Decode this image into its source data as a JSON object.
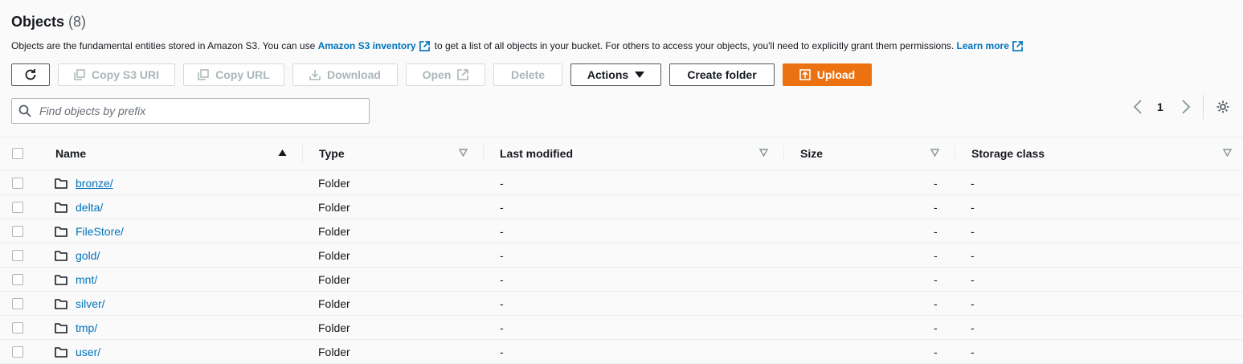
{
  "header": {
    "title": "Objects",
    "count": "(8)"
  },
  "description": {
    "part1": "Objects are the fundamental entities stored in Amazon S3. You can use ",
    "link1": "Amazon S3 inventory",
    "part2": "to get a list of all objects in your bucket. For others to access your objects, you'll need to explicitly grant them permissions. ",
    "link2": "Learn more"
  },
  "toolbar": {
    "copy_s3_uri": "Copy S3 URI",
    "copy_url": "Copy URL",
    "download": "Download",
    "open": "Open",
    "delete": "Delete",
    "actions": "Actions",
    "create_folder": "Create folder",
    "upload": "Upload"
  },
  "search": {
    "placeholder": "Find objects by prefix"
  },
  "pagination": {
    "page": "1"
  },
  "table": {
    "columns": [
      "Name",
      "Type",
      "Last modified",
      "Size",
      "Storage class"
    ],
    "rows": [
      {
        "name": "bronze/",
        "type": "Folder",
        "last_modified": "-",
        "size": "-",
        "storage_class": "-"
      },
      {
        "name": "delta/",
        "type": "Folder",
        "last_modified": "-",
        "size": "-",
        "storage_class": "-"
      },
      {
        "name": "FileStore/",
        "type": "Folder",
        "last_modified": "-",
        "size": "-",
        "storage_class": "-"
      },
      {
        "name": "gold/",
        "type": "Folder",
        "last_modified": "-",
        "size": "-",
        "storage_class": "-"
      },
      {
        "name": "mnt/",
        "type": "Folder",
        "last_modified": "-",
        "size": "-",
        "storage_class": "-"
      },
      {
        "name": "silver/",
        "type": "Folder",
        "last_modified": "-",
        "size": "-",
        "storage_class": "-"
      },
      {
        "name": "tmp/",
        "type": "Folder",
        "last_modified": "-",
        "size": "-",
        "storage_class": "-"
      },
      {
        "name": "user/",
        "type": "Folder",
        "last_modified": "-",
        "size": "-",
        "storage_class": "-"
      }
    ]
  },
  "colors": {
    "link": "#0073bb",
    "primary": "#ec7211",
    "disabled": "#aab7b8"
  }
}
